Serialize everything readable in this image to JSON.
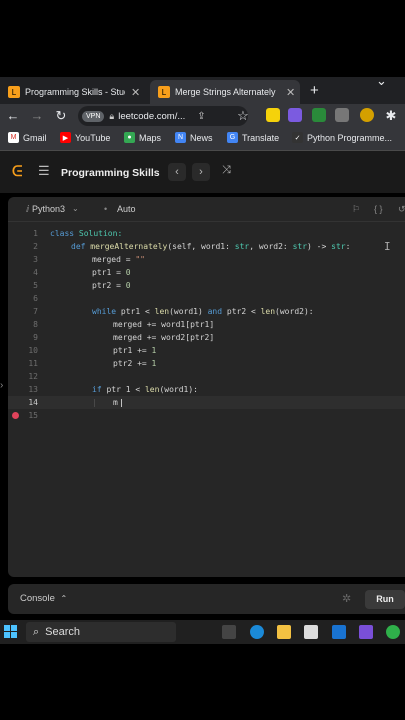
{
  "browser": {
    "tabs": [
      {
        "label": "Programming Skills - Stud",
        "active": false
      },
      {
        "label": "Merge Strings Alternately",
        "active": true
      }
    ],
    "new_tab": "+",
    "chevron": "⌄",
    "vpn": "VPN",
    "url": "leetcode.com/...",
    "bookmarks": [
      "Gmail",
      "YouTube",
      "Maps",
      "News",
      "Translate",
      "Python Programme..."
    ]
  },
  "leetcode": {
    "title": "Programming Skills",
    "language": "Python3",
    "autosave": "Auto",
    "console_label": "Console",
    "run_label": "Run"
  },
  "code_lines": [
    "1",
    "2",
    "3",
    "4",
    "5",
    "6",
    "7",
    "8",
    "9",
    "10",
    "11",
    "12",
    "13",
    "14",
    "15"
  ],
  "code": {
    "l1a": "class ",
    "l1b": "Solution:",
    "l2a": "def ",
    "l2b": "mergeAlternately",
    "l2c": "(self, word1: ",
    "l2d": "str",
    "l2e": ", word2: ",
    "l2f": "str",
    "l2g": ") -> ",
    "l2h": "str",
    "l2i": ":",
    "l3a": "merged = ",
    "l3b": "\"\"",
    "l4a": "ptr1 = ",
    "l4b": "0",
    "l5a": "ptr2 = ",
    "l5b": "0",
    "l7a": "while ",
    "l7b": "ptr1 < ",
    "l7c": "len",
    "l7d": "(word1) ",
    "l7e": "and ",
    "l7f": "ptr2 < ",
    "l7g": "len",
    "l7h": "(word2):",
    "l8": "merged += word1[ptr1]",
    "l9": "merged += word2[ptr2]",
    "l10a": "ptr1 += ",
    "l10b": "1",
    "l11a": "ptr2 += ",
    "l11b": "1",
    "l13a": "if ",
    "l13b": "ptr 1 < ",
    "l13c": "len",
    "l13d": "(word1):",
    "l14": "m"
  },
  "taskbar": {
    "search_label": "Search"
  },
  "colors": {
    "chrome_bg": "#202124",
    "editor_bg": "#262626",
    "keyword": "#569cd6",
    "breakpoint": "#e0435b"
  }
}
